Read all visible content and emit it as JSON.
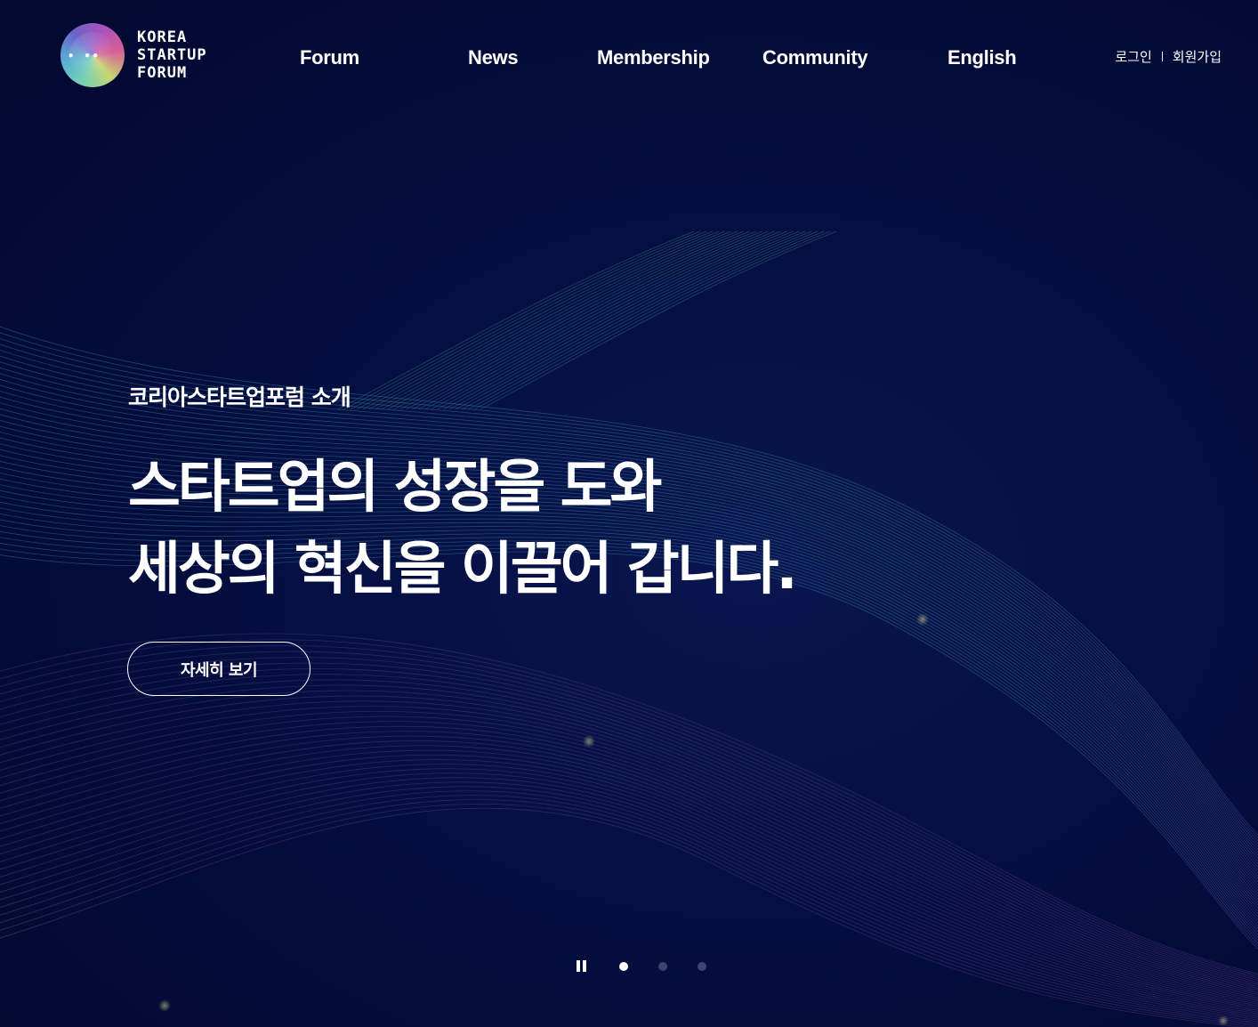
{
  "logo": {
    "lines": [
      "KOREA",
      "STARTUP",
      "FORUM"
    ],
    "icon": "gradient-circle-logo-icon"
  },
  "nav": {
    "items": [
      {
        "label": "Forum"
      },
      {
        "label": "News"
      },
      {
        "label": "Membership"
      },
      {
        "label": "Community"
      },
      {
        "label": "English"
      }
    ]
  },
  "auth": {
    "login": "로그인",
    "signup": "회원가입"
  },
  "hero": {
    "subtitle": "코리아스타트업포럼 소개",
    "headline_line1": "스타트업의 성장을 도와",
    "headline_line2": "세상의 혁신을 이끌어 갑니다.",
    "more_button": "자세히 보기"
  },
  "slider": {
    "current_slide": 1,
    "total_slides": 3,
    "pause_icon": "pause-icon"
  },
  "colors": {
    "background": "#020c36",
    "text": "#ffffff",
    "inactive_dot": "#3a4570"
  }
}
